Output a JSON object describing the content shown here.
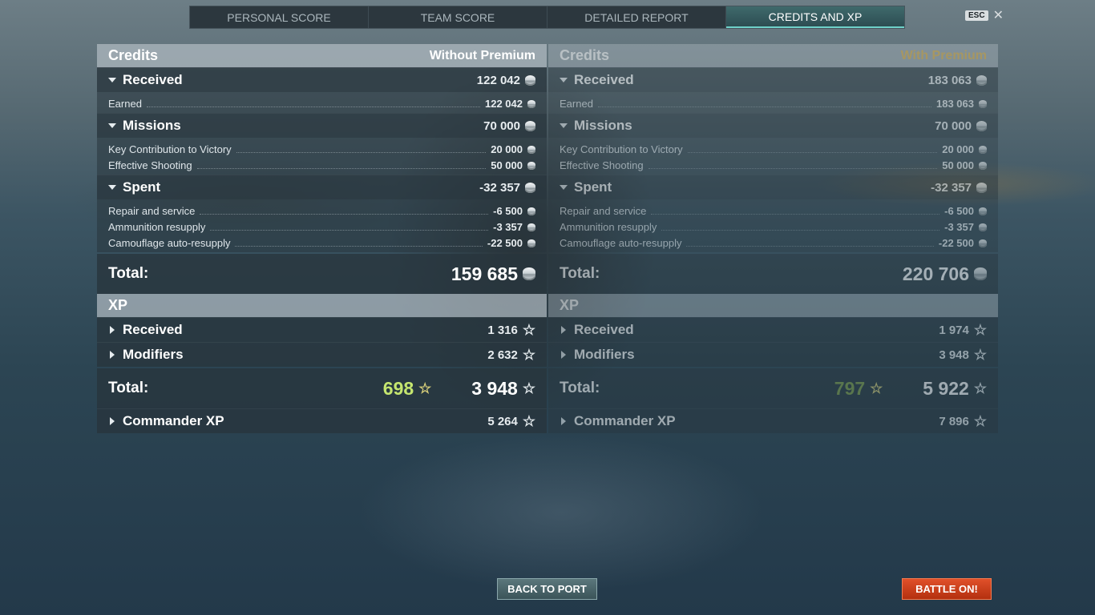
{
  "tabs": [
    {
      "label": "PERSONAL SCORE"
    },
    {
      "label": "TEAM SCORE"
    },
    {
      "label": "DETAILED REPORT"
    },
    {
      "label": "CREDITS AND XP",
      "active": true
    }
  ],
  "esc_label": "ESC",
  "close_glyph": "✕",
  "left": {
    "credits_title": "Credits",
    "mode": "Without Premium",
    "received": {
      "label": "Received",
      "value": "122 042",
      "items": [
        {
          "label": "Earned",
          "value": "122 042"
        }
      ]
    },
    "missions": {
      "label": "Missions",
      "value": "70 000",
      "items": [
        {
          "label": "Key Contribution to Victory",
          "value": "20 000"
        },
        {
          "label": "Effective Shooting",
          "value": "50 000"
        }
      ]
    },
    "spent": {
      "label": "Spent",
      "value": "-32 357",
      "items": [
        {
          "label": "Repair and service",
          "value": "-6 500"
        },
        {
          "label": "Ammunition resupply",
          "value": "-3 357"
        },
        {
          "label": "Camouflage auto-resupply",
          "value": "-22 500"
        }
      ]
    },
    "credits_total": {
      "label": "Total:",
      "value": "159 685"
    },
    "xp_title": "XP",
    "xp_received": {
      "label": "Received",
      "value": "1 316"
    },
    "xp_modifiers": {
      "label": "Modifiers",
      "value": "2 632"
    },
    "xp_total": {
      "label": "Total:",
      "premium_value": "698",
      "value": "3 948"
    },
    "commander_xp": {
      "label": "Commander XP",
      "value": "5 264"
    }
  },
  "right": {
    "credits_title": "Credits",
    "mode": "With Premium",
    "received": {
      "label": "Received",
      "value": "183 063",
      "items": [
        {
          "label": "Earned",
          "value": "183 063"
        }
      ]
    },
    "missions": {
      "label": "Missions",
      "value": "70 000",
      "items": [
        {
          "label": "Key Contribution to Victory",
          "value": "20 000"
        },
        {
          "label": "Effective Shooting",
          "value": "50 000"
        }
      ]
    },
    "spent": {
      "label": "Spent",
      "value": "-32 357",
      "items": [
        {
          "label": "Repair and service",
          "value": "-6 500"
        },
        {
          "label": "Ammunition resupply",
          "value": "-3 357"
        },
        {
          "label": "Camouflage auto-resupply",
          "value": "-22 500"
        }
      ]
    },
    "credits_total": {
      "label": "Total:",
      "value": "220 706"
    },
    "xp_title": "XP",
    "xp_received": {
      "label": "Received",
      "value": "1 974"
    },
    "xp_modifiers": {
      "label": "Modifiers",
      "value": "3 948"
    },
    "xp_total": {
      "label": "Total:",
      "premium_value": "797",
      "value": "5 922"
    },
    "commander_xp": {
      "label": "Commander XP",
      "value": "7 896"
    }
  },
  "buttons": {
    "back_to_port": "BACK TO PORT",
    "battle_on": "BATTLE ON!"
  },
  "icons": {
    "credits": "credits-coin-icon",
    "xp": "xp-star-icon"
  },
  "colors": {
    "active_tab_accent": "#6fd1c9",
    "premium_gold": "#e0b44d",
    "premium_xp_green": "#c5e66f",
    "battle_button": "#c8401a"
  }
}
